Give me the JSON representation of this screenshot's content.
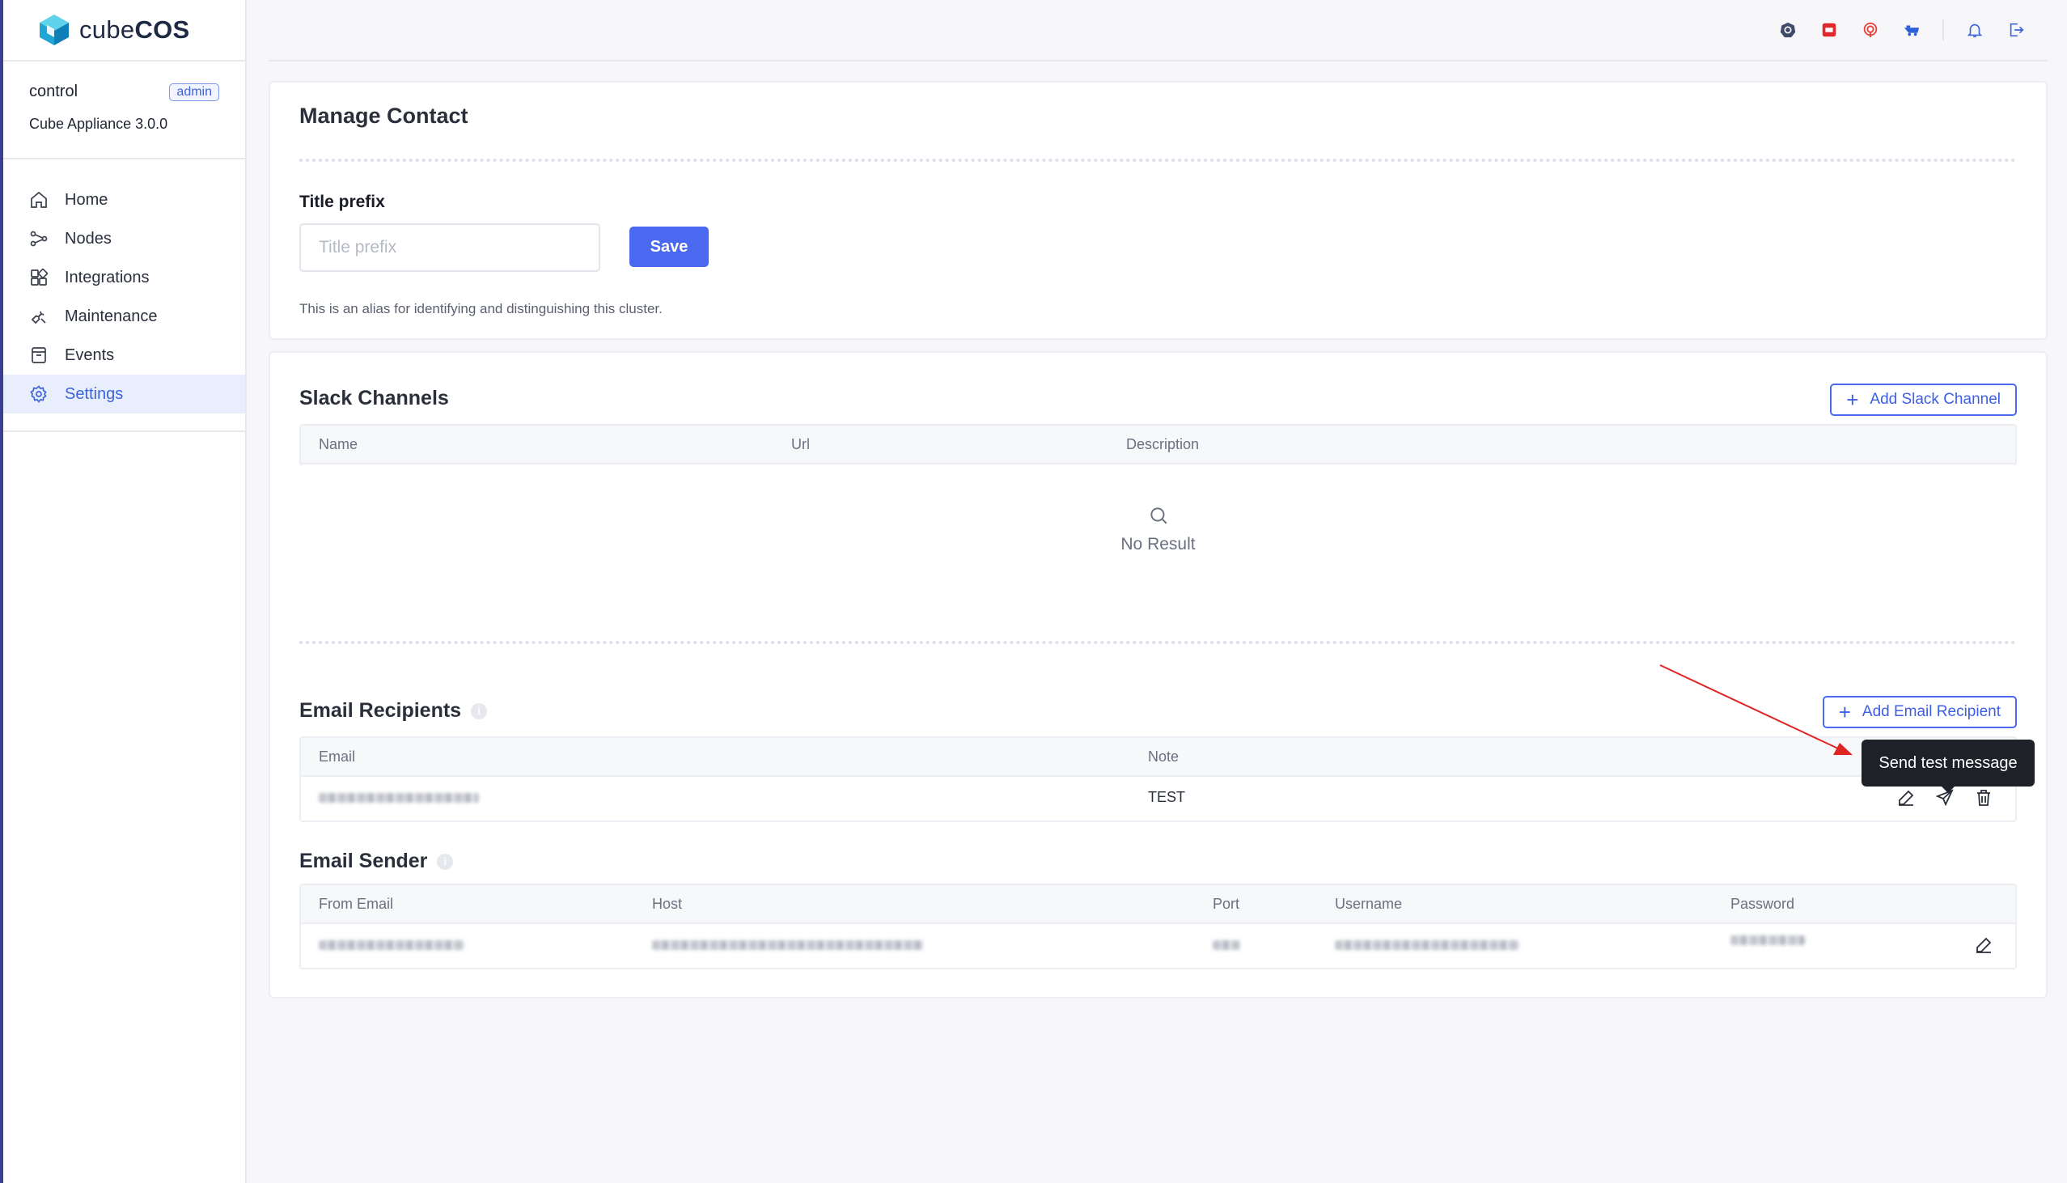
{
  "brand": {
    "name_light": "cube",
    "name_bold": "COS"
  },
  "account": {
    "user": "control",
    "role": "admin",
    "version": "Cube Appliance 3.0.0"
  },
  "nav": {
    "items": [
      {
        "label": "Home",
        "icon": "home-icon"
      },
      {
        "label": "Nodes",
        "icon": "nodes-icon"
      },
      {
        "label": "Integrations",
        "icon": "integrations-icon"
      },
      {
        "label": "Maintenance",
        "icon": "maintenance-icon"
      },
      {
        "label": "Events",
        "icon": "events-icon"
      },
      {
        "label": "Settings",
        "icon": "settings-icon",
        "active": true
      }
    ]
  },
  "topbar": {
    "icons": [
      "kubernetes-icon",
      "openstack-icon",
      "ceph-icon",
      "storage-icon",
      "bell-icon",
      "logout-icon"
    ]
  },
  "manage_contact": {
    "title": "Manage Contact",
    "field_label": "Title prefix",
    "input_value": "",
    "input_placeholder": "Title prefix",
    "save_label": "Save",
    "hint": "This is an alias for identifying and distinguishing this cluster."
  },
  "slack": {
    "title": "Slack Channels",
    "add_label": "Add Slack Channel",
    "columns": [
      "Name",
      "Url",
      "Description"
    ],
    "empty_text": "No Result"
  },
  "email_recipients": {
    "title": "Email Recipients",
    "add_label": "Add Email Recipient",
    "columns": [
      "Email",
      "Note"
    ],
    "rows": [
      {
        "email": "",
        "note": "TEST"
      }
    ],
    "tooltip": "Send test message"
  },
  "email_sender": {
    "title": "Email Sender",
    "columns": [
      "From Email",
      "Host",
      "Port",
      "Username",
      "Password"
    ]
  },
  "colors": {
    "accent": "#4b68f0",
    "annotation_arrow": "#e02424",
    "sidebar_edge": "#3b3f8f"
  }
}
